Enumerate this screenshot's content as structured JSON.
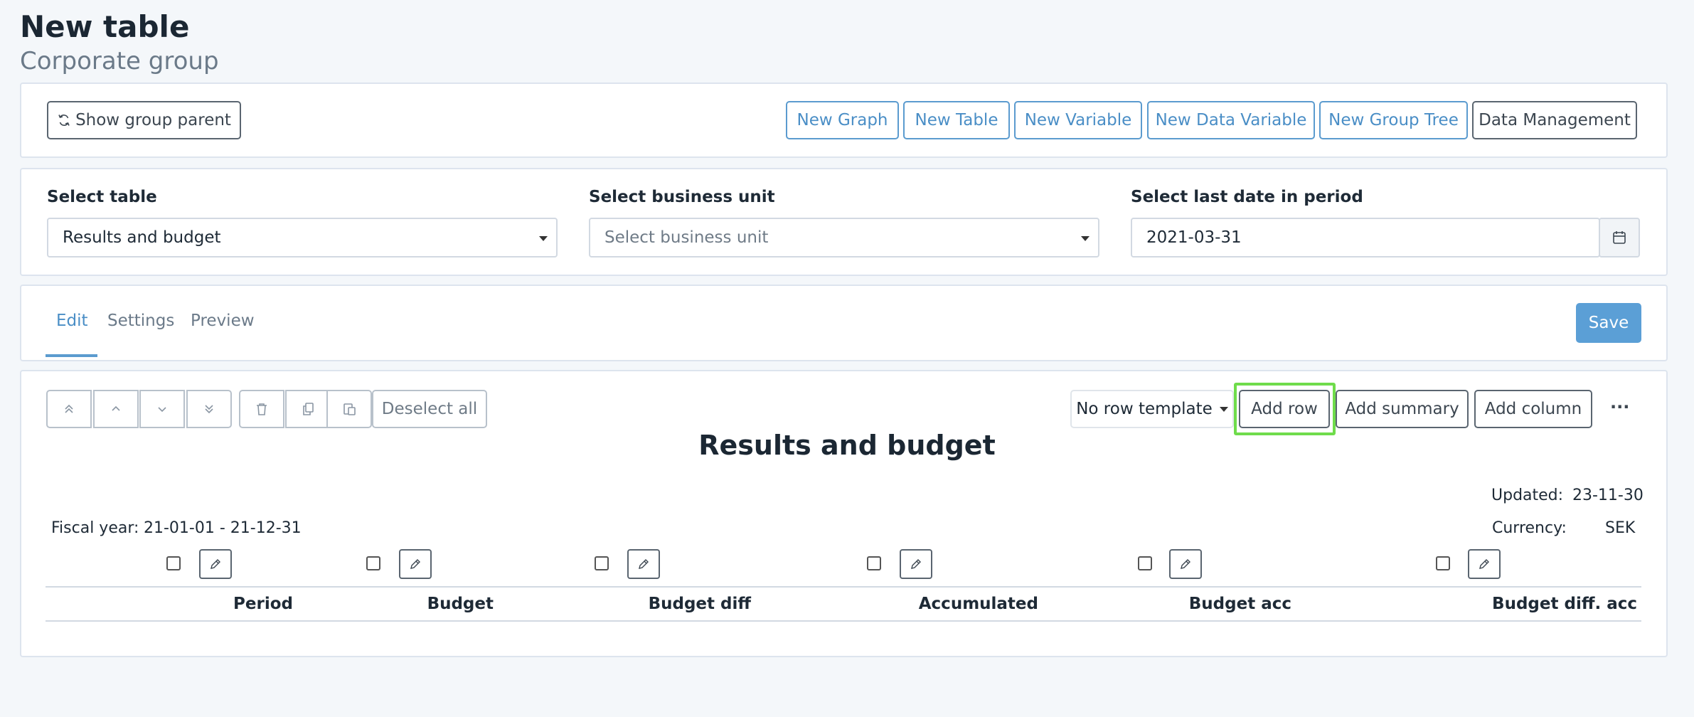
{
  "page": {
    "title": "New table",
    "subtitle": "Corporate group"
  },
  "toolbar": {
    "show_group_parent": "Show group parent",
    "new_graph": "New Graph",
    "new_table": "New Table",
    "new_variable": "New Variable",
    "new_data_variable": "New Data Variable",
    "new_group_tree": "New Group Tree",
    "data_management": "Data Management"
  },
  "filters": {
    "select_table_label": "Select table",
    "select_table_value": "Results and budget",
    "business_unit_label": "Select business unit",
    "business_unit_placeholder": "Select business unit",
    "last_date_label": "Select last date in period",
    "last_date_value": "2021-03-31"
  },
  "tabs": [
    {
      "label": "Edit",
      "active": true
    },
    {
      "label": "Settings",
      "active": false
    },
    {
      "label": "Preview",
      "active": false
    }
  ],
  "save_label": "Save",
  "editor": {
    "deselect_all": "Deselect all",
    "row_template": "No row template",
    "add_row": "Add row",
    "add_summary": "Add summary",
    "add_column": "Add column",
    "more": "···",
    "highlight_color": "#6fdc4b"
  },
  "table": {
    "title": "Results and budget",
    "updated_label": "Updated:",
    "updated_value": "23-11-30",
    "fiscal_year_label": "Fiscal year:",
    "fiscal_year_value": "21-01-01 - 21-12-31",
    "currency_label": "Currency:",
    "currency_value": "SEK",
    "columns": [
      "Period",
      "Budget",
      "Budget diff",
      "Accumulated",
      "Budget acc",
      "Budget diff. acc"
    ]
  },
  "colors": {
    "accent": "#5b9bcf",
    "save_bg": "#5b9fd6",
    "background": "#f4f7fa"
  }
}
